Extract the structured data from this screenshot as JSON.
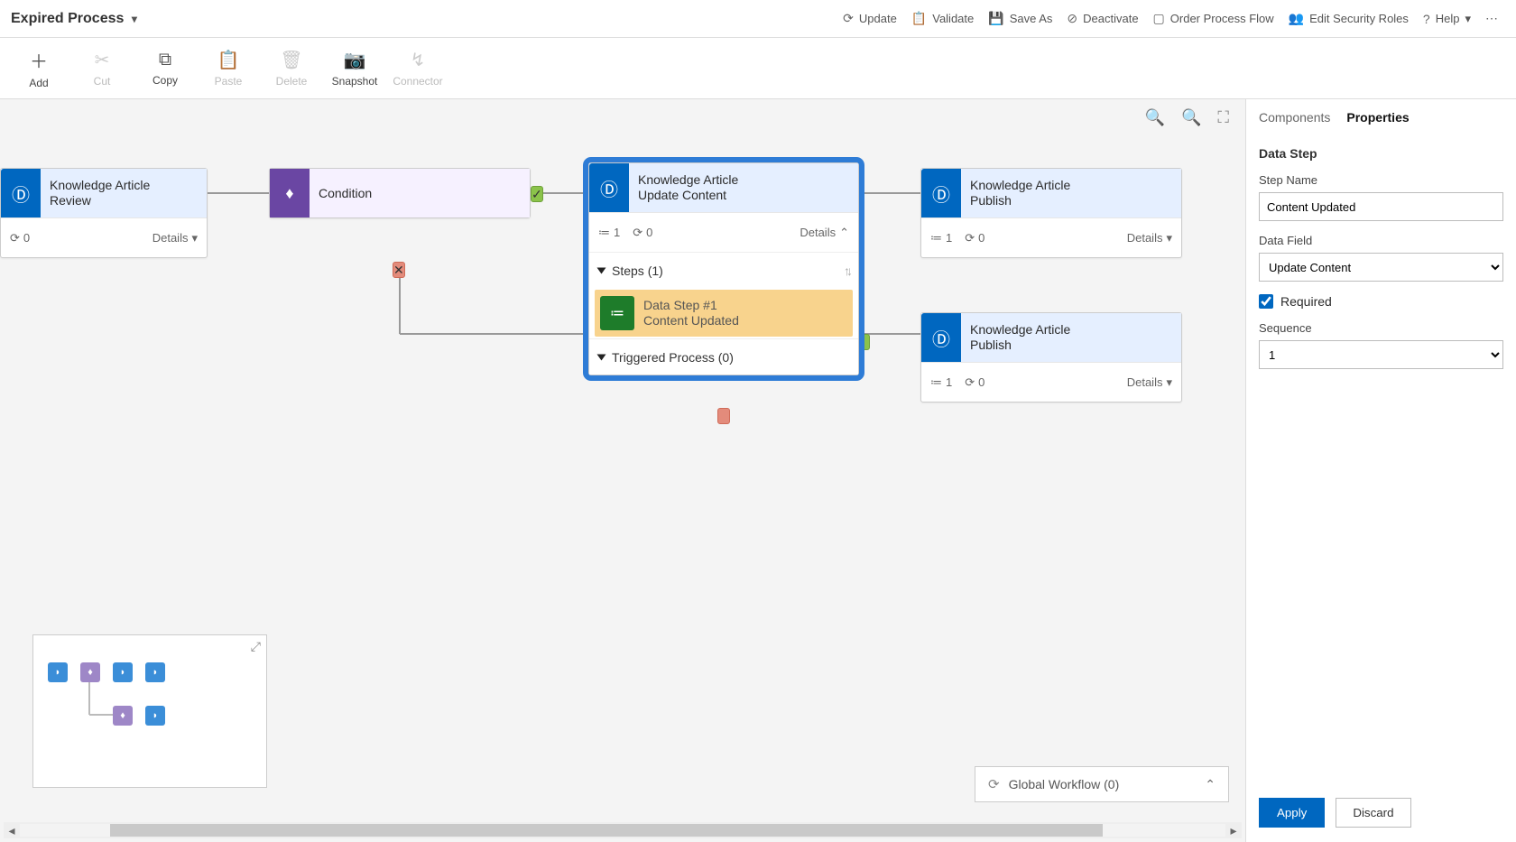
{
  "title": "Expired Process",
  "header_actions": {
    "update": "Update",
    "validate": "Validate",
    "save_as": "Save As",
    "deactivate": "Deactivate",
    "order": "Order Process Flow",
    "security": "Edit Security Roles",
    "help": "Help"
  },
  "ribbon": {
    "add": "Add",
    "cut": "Cut",
    "copy": "Copy",
    "paste": "Paste",
    "delete": "Delete",
    "snapshot": "Snapshot",
    "connector": "Connector"
  },
  "nodes": {
    "n1": {
      "line1": "Knowledge Article",
      "line2": "Review",
      "count1": "0",
      "details": "Details"
    },
    "cond": {
      "label": "Condition"
    },
    "n3": {
      "line1": "Knowledge Article",
      "line2": "Update Content",
      "count1": "1",
      "count2": "0",
      "details": "Details",
      "steps_header": "Steps (1)",
      "ds_title": "Data Step #1",
      "ds_sub": "Content Updated",
      "trigger": "Triggered Process (0)"
    },
    "n4": {
      "line1": "Knowledge Article",
      "line2": "Publish",
      "count1": "1",
      "count2": "0",
      "details": "Details"
    },
    "n5": {
      "line1": "Knowledge Article",
      "line2": "Publish",
      "count1": "1",
      "count2": "0",
      "details": "Details"
    }
  },
  "global_workflow": "Global Workflow (0)",
  "panel": {
    "tab_components": "Components",
    "tab_properties": "Properties",
    "section_title": "Data Step",
    "step_name_label": "Step Name",
    "step_name_value": "Content Updated",
    "data_field_label": "Data Field",
    "data_field_value": "Update Content",
    "required_label": "Required",
    "sequence_label": "Sequence",
    "sequence_value": "1",
    "apply": "Apply",
    "discard": "Discard"
  }
}
